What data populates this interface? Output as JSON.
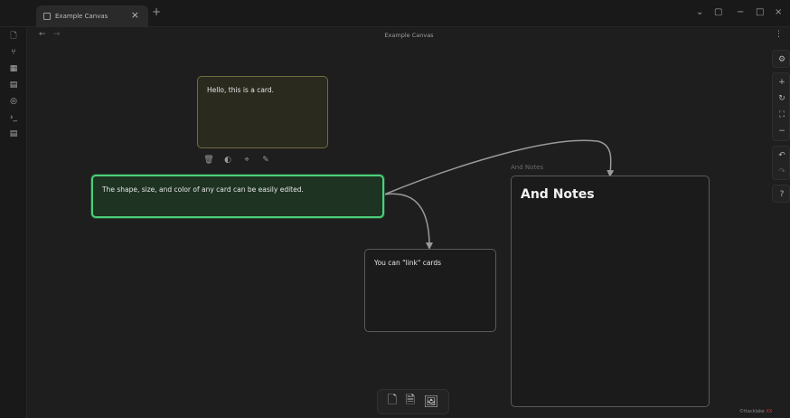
{
  "tab": {
    "title": "Example Canvas",
    "close": "×",
    "new": "+"
  },
  "header": {
    "title": "Example Canvas",
    "back": "←",
    "forward": "→",
    "more": "⋮"
  },
  "window_controls": {
    "chevron": "⌄",
    "layout": "▢",
    "minimize": "−",
    "maximize": "□",
    "close": "×"
  },
  "ribbon": {
    "icons": [
      "file-icon",
      "graph-icon",
      "grid-icon",
      "calendar-icon",
      "random-icon",
      "terminal-icon",
      "tag-icon"
    ],
    "glyphs": [
      "🗋",
      "⑂",
      "▦",
      "▤",
      "◎",
      "›_",
      "▤"
    ]
  },
  "cards": {
    "hello": "Hello, this is a card.",
    "shape": "The shape, size, and color of any card can be easily edited.",
    "link": "You can \"link\" cards",
    "notes_label": "And Notes",
    "notes_heading": "And Notes"
  },
  "card_toolbar": {
    "trash": "🗑",
    "palette": "◐",
    "zoom": "⌖",
    "edit": "✎"
  },
  "right_controls": {
    "settings": "⚙",
    "zoom_in": "+",
    "reset": "↻",
    "fit": "⛶",
    "zoom_out": "−",
    "undo": "↶",
    "redo": "↷",
    "help": "?"
  },
  "bottom_bar": {
    "card": "🗋",
    "note": "🗎",
    "media": "🖼"
  },
  "watermark": {
    "text": "©ttacklake",
    "mark": "XX"
  },
  "colors": {
    "selected_border": "#4bd07a",
    "card_yellow_border": "#6f6c3e",
    "edge": "#9a9a9a"
  }
}
